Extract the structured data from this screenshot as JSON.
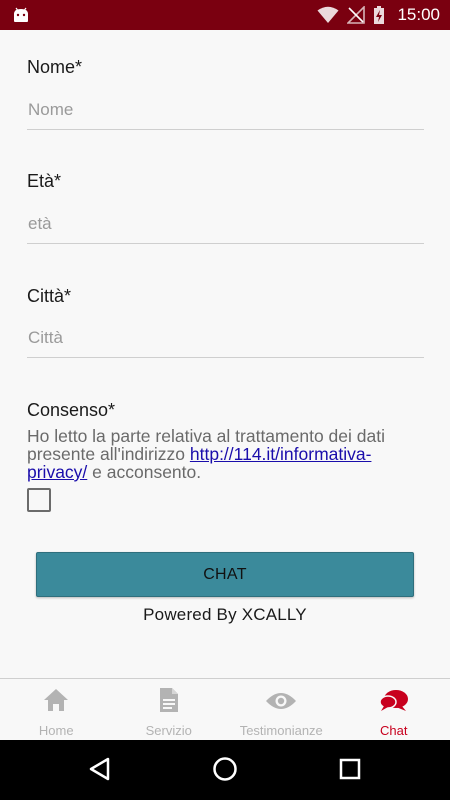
{
  "status_bar": {
    "time": "15:00",
    "bg_color": "#7a0010",
    "icons": [
      "android-icon",
      "wifi-icon",
      "no-signal-icon",
      "battery-charging-icon"
    ]
  },
  "form": {
    "nome": {
      "label": "Nome*",
      "placeholder": "Nome",
      "value": ""
    },
    "eta": {
      "label": "Età*",
      "placeholder": "età",
      "value": ""
    },
    "citta": {
      "label": "Città*",
      "placeholder": "Città",
      "value": ""
    },
    "consenso": {
      "label": "Consenso*",
      "text_before": "Ho letto la parte relativa al trattamento dei dati presente all'indirizzo ",
      "link_text": "http://114.it/informativa-privacy/",
      "text_after": " e acconsento.",
      "checked": false
    },
    "chat_button_label": "CHAT",
    "powered_by": "Powered By XCALLY",
    "button_color": "#3b8a9b"
  },
  "tabbar": {
    "active_color": "#c8001e",
    "tabs": [
      {
        "label": "Home",
        "icon": "home-icon",
        "active": false
      },
      {
        "label": "Servizio",
        "icon": "document-icon",
        "active": false
      },
      {
        "label": "Testimonianze",
        "icon": "eye-icon",
        "active": false
      },
      {
        "label": "Chat",
        "icon": "chat-bubbles-icon",
        "active": true
      }
    ]
  },
  "navbar": {
    "icons": [
      "back-icon",
      "home-circle-icon",
      "recents-icon"
    ]
  }
}
